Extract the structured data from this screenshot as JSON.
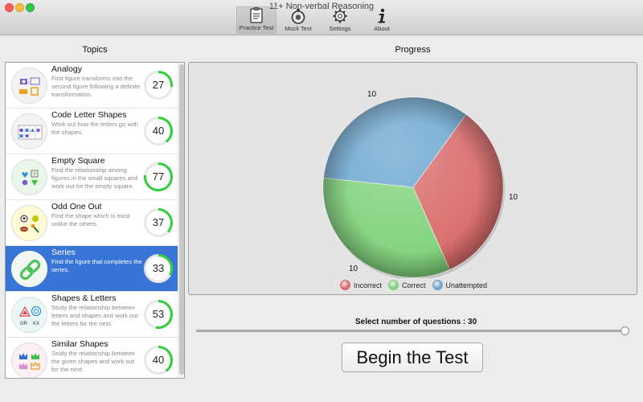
{
  "window": {
    "title": "11+ Non-verbal Reasoning"
  },
  "toolbar": {
    "items": [
      {
        "label": "Practice Test",
        "icon": "clipboard-icon"
      },
      {
        "label": "Mock Test",
        "icon": "stopwatch-icon"
      },
      {
        "label": "Settings",
        "icon": "gear-icon"
      },
      {
        "label": "About",
        "icon": "info-icon"
      }
    ],
    "active": "Practice Test"
  },
  "topics": {
    "heading": "Topics",
    "selected": "Series",
    "items": [
      {
        "name": "Analogy",
        "description": "First figure transforms into the second figure following a definite transformation.",
        "score": "27",
        "score_value": 27,
        "icon": "analogy-icon"
      },
      {
        "name": "Code Letter Shapes",
        "description": "Work out how the letters go with the shapes.",
        "score": "40",
        "score_value": 40,
        "icon": "code-letter-shapes-icon"
      },
      {
        "name": "Empty Square",
        "description": "Find the relationship among figures in the small squares and work out for the empty square.",
        "score": "77",
        "score_value": 77,
        "icon": "empty-square-icon"
      },
      {
        "name": "Odd One Out",
        "description": "Find the shape which is most unlike the others.",
        "score": "37",
        "score_value": 37,
        "icon": "odd-one-out-icon"
      },
      {
        "name": "Series",
        "description": "Find the figure that completes the series.",
        "score": "33",
        "score_value": 33,
        "icon": "chain-link-icon"
      },
      {
        "name": "Shapes & Letters",
        "description": "Study the relationship between letters and shapes and work out the letters for the next.",
        "score": "53",
        "score_value": 53,
        "icon": "shapes-letters-icon",
        "icon_letters": [
          "GR",
          "KX"
        ]
      },
      {
        "name": "Similar Shapes",
        "description": "Study the relationship between the given shapes and work out for the next.",
        "score": "40",
        "score_value": 40,
        "icon": "crowns-icon"
      }
    ]
  },
  "progress": {
    "heading": "Progress",
    "chart_data": {
      "type": "pie",
      "slices": [
        {
          "name": "Incorrect",
          "value": 10,
          "label": "10",
          "color": "#d96a6a"
        },
        {
          "name": "Correct",
          "value": 10,
          "label": "10",
          "color": "#7fd27a"
        },
        {
          "name": "Unattempted",
          "value": 10,
          "label": "10",
          "color": "#6aa6d0"
        }
      ],
      "legend_placement": "bottom"
    }
  },
  "questions": {
    "label": "Select number of questions : 30",
    "value": 30,
    "fraction": 1.0
  },
  "begin_button": {
    "label": "Begin the Test"
  },
  "colors": {
    "accent": "#3875d7",
    "score_ring": "#2fcf3a"
  }
}
